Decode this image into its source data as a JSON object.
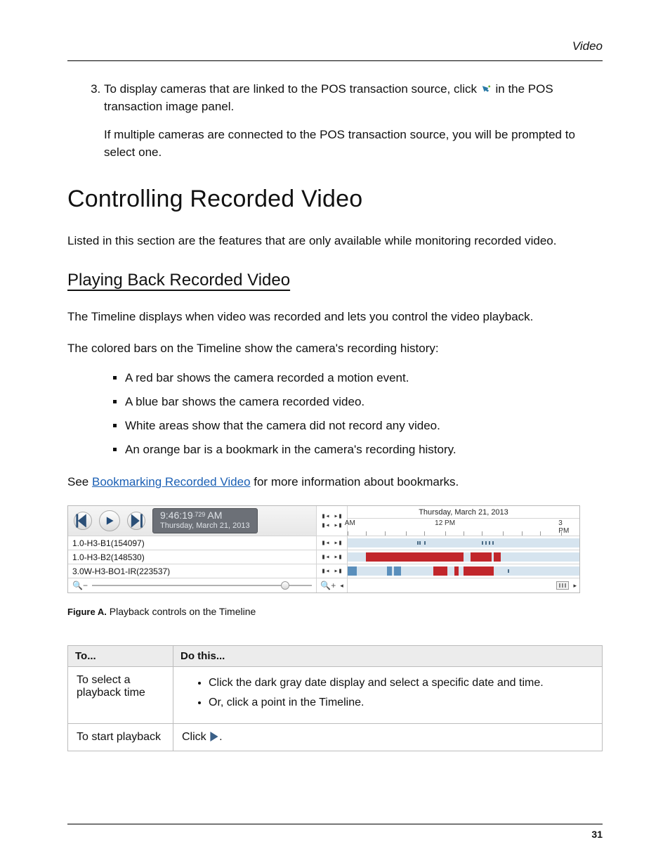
{
  "running_head": "Video",
  "page_number": "31",
  "step3_num": "3",
  "step3": {
    "part_a": "To display cameras that are linked to the POS transaction source, click ",
    "part_b": " in the POS transaction image panel.",
    "note": "If multiple cameras are connected to the POS transaction source, you will be prompted to select one."
  },
  "h1": "Controlling Recorded Video",
  "intro": "Listed in this section are the features that are only available while monitoring recorded video.",
  "h2": "Playing Back Recorded Video",
  "p1": "The Timeline displays when video was recorded and lets you control the video playback.",
  "p2": "The colored bars on the Timeline show the camera's recording history:",
  "bullets": [
    "A red bar shows the camera recorded a motion event.",
    "A blue bar shows the camera recorded video.",
    "White areas show that the camera did not record any video.",
    "An orange bar is a bookmark in the camera's recording history."
  ],
  "see_prefix": "See ",
  "see_link": "Bookmarking Recorded Video",
  "see_suffix": " for more information about bookmarks.",
  "timeline": {
    "time": "9:46:19",
    "ms": ".729",
    "ampm": " AM",
    "date": "Thursday, March 21, 2013",
    "header_date": "Thursday, March 21, 2013",
    "am_label": "AM",
    "noon_label": "12 PM",
    "pm_label": "3 PM",
    "cameras": [
      "1.0-H3-B1(154097)",
      "1.0-H3-B2(148530)",
      "3.0W-H3-BO1-IR(223537)"
    ]
  },
  "figure_label": "Figure A.",
  "figure_caption": " Playback controls on the Timeline",
  "table": {
    "head_to": "To...",
    "head_do": "Do this...",
    "rows": [
      {
        "to": "To select a playback time",
        "items": [
          "Click the dark gray date display and select a specific date and time.",
          "Or, click a point in the Timeline."
        ]
      },
      {
        "to": "To start playback",
        "click_label": "Click ",
        "after": "."
      }
    ]
  }
}
